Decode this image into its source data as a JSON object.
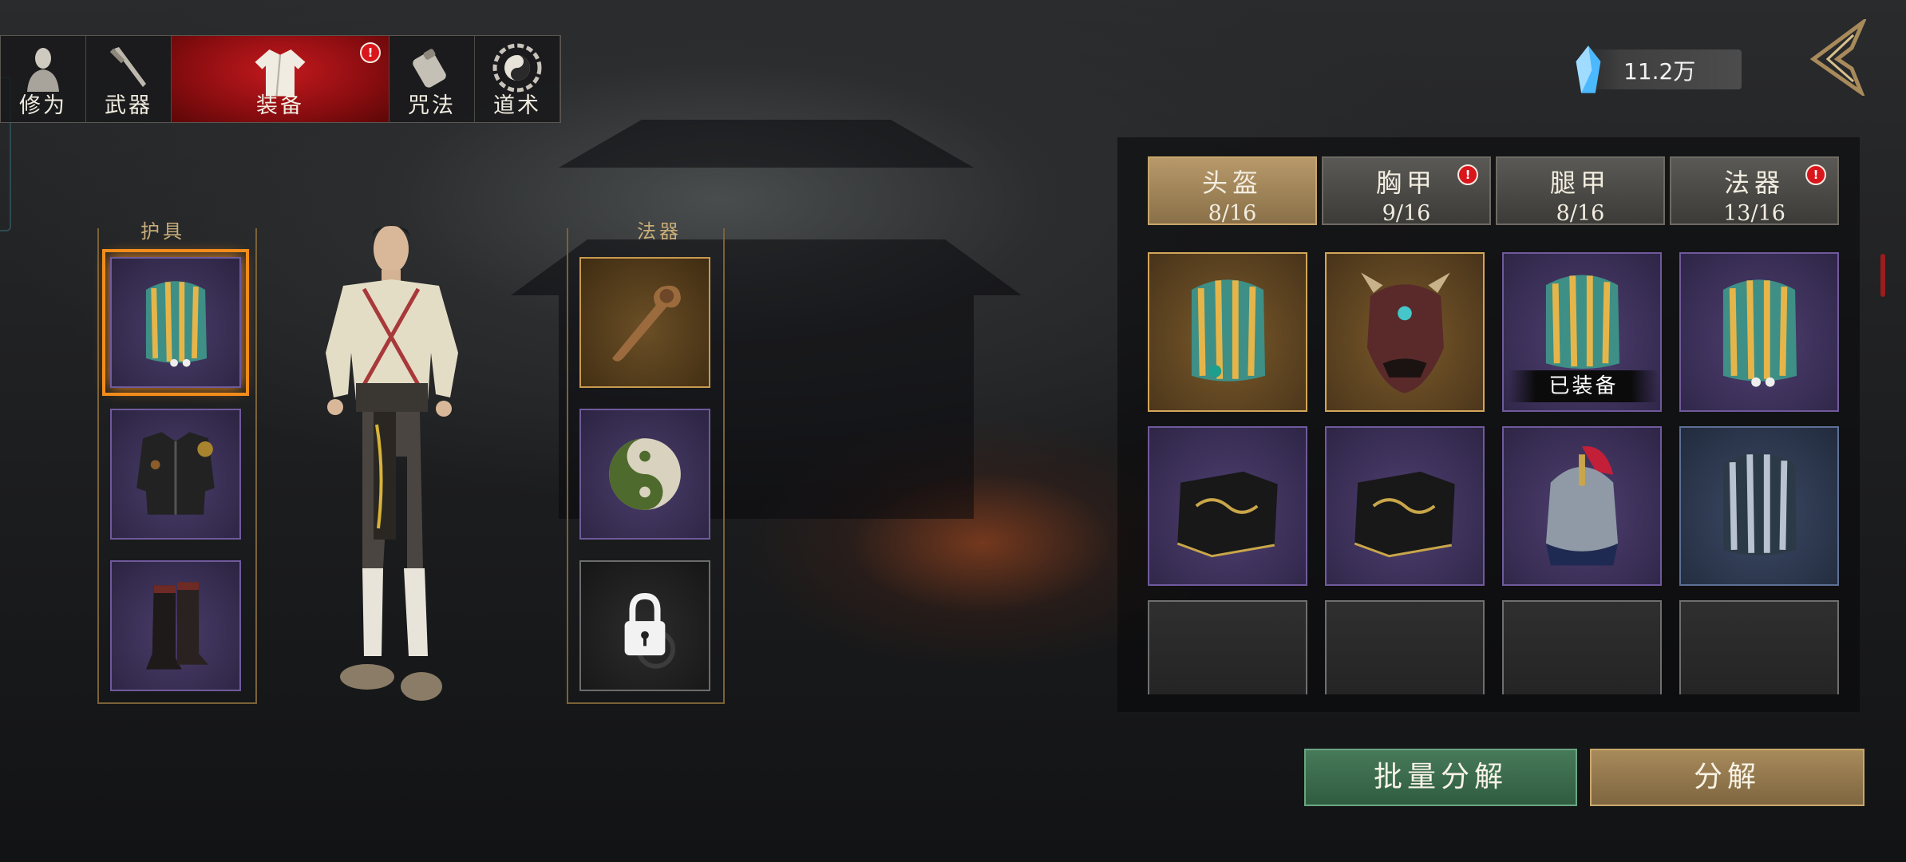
{
  "top_tabs": [
    {
      "label": "修为",
      "icon": "cultivation-figure-icon",
      "active": false,
      "badge": ""
    },
    {
      "label": "武器",
      "icon": "sword-icon",
      "active": false,
      "badge": ""
    },
    {
      "label": "装备",
      "icon": "robe-icon",
      "active": true,
      "badge": "!"
    },
    {
      "label": "咒法",
      "icon": "scroll-talisman-icon",
      "active": false,
      "badge": ""
    },
    {
      "label": "道术",
      "icon": "taiji-bagua-icon",
      "active": false,
      "badge": ""
    }
  ],
  "left_panel": {
    "armor_title": "护具",
    "artifact_title": "法器",
    "armor_slots": [
      {
        "item": "golden-shoulder-helmet",
        "selected": true
      },
      {
        "item": "black-armor-chest",
        "selected": false
      },
      {
        "item": "black-boots",
        "selected": false
      }
    ],
    "artifact_slots": [
      {
        "item": "ruyi-scepter",
        "state": "gold"
      },
      {
        "item": "taiji-orb",
        "state": "purple"
      },
      {
        "item": "lock",
        "state": "locked"
      }
    ]
  },
  "currency": {
    "icon": "blue-crystal-icon",
    "value": "11.2万"
  },
  "category_tabs": [
    {
      "label": "头盔",
      "count": "8/16",
      "active": true,
      "badge": ""
    },
    {
      "label": "胸甲",
      "count": "9/16",
      "active": false,
      "badge": "!"
    },
    {
      "label": "腿甲",
      "count": "8/16",
      "active": false,
      "badge": ""
    },
    {
      "label": "法器",
      "count": "13/16",
      "active": false,
      "badge": "!"
    }
  ],
  "inventory": [
    {
      "item": "golden-crest-helmet",
      "rarity": "gold",
      "tag": ""
    },
    {
      "item": "demon-mask-helmet",
      "rarity": "gold",
      "tag": ""
    },
    {
      "item": "golden-crest-helmet",
      "rarity": "purple",
      "tag": "已装备"
    },
    {
      "item": "golden-crest-helmet",
      "rarity": "purple",
      "tag": ""
    },
    {
      "item": "black-cloth-hat",
      "rarity": "purple",
      "tag": ""
    },
    {
      "item": "black-cloth-hat",
      "rarity": "purple",
      "tag": ""
    },
    {
      "item": "plumed-war-helmet",
      "rarity": "purple",
      "tag": ""
    },
    {
      "item": "silver-crest-helmet",
      "rarity": "blue",
      "tag": ""
    },
    {
      "item": "",
      "rarity": "empty",
      "tag": ""
    },
    {
      "item": "",
      "rarity": "empty",
      "tag": ""
    },
    {
      "item": "",
      "rarity": "empty",
      "tag": ""
    },
    {
      "item": "",
      "rarity": "empty",
      "tag": ""
    }
  ],
  "buttons": {
    "batch_decompose": "批量分解",
    "decompose": "分解"
  },
  "colors": {
    "accent_red": "#c3191d",
    "select_orange": "#f28c1a",
    "gold": "#c99a4e",
    "purple": "#6f5a9c",
    "green_button": "#477a59",
    "tan_button": "#a88a5b"
  }
}
